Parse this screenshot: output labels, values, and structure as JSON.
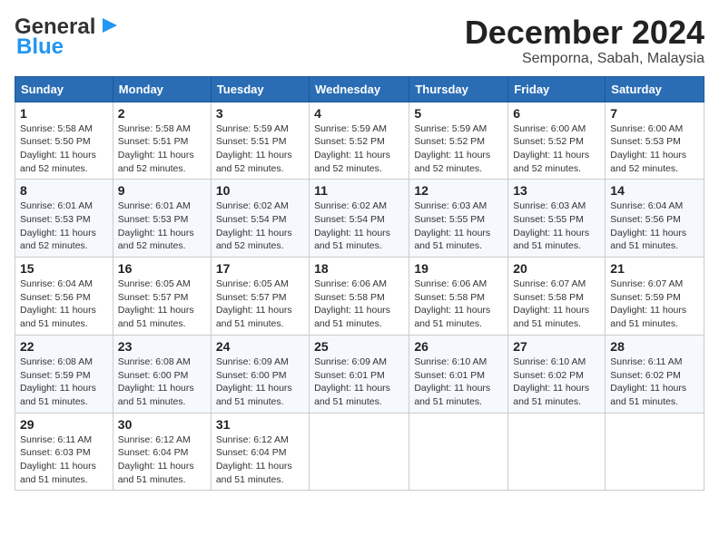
{
  "logo": {
    "part1": "General",
    "part2": "Blue"
  },
  "title": {
    "month": "December 2024",
    "location": "Semporna, Sabah, Malaysia"
  },
  "weekdays": [
    "Sunday",
    "Monday",
    "Tuesday",
    "Wednesday",
    "Thursday",
    "Friday",
    "Saturday"
  ],
  "weeks": [
    [
      {
        "day": "1",
        "sunrise": "5:58 AM",
        "sunset": "5:50 PM",
        "daylight": "11 hours and 52 minutes."
      },
      {
        "day": "2",
        "sunrise": "5:58 AM",
        "sunset": "5:51 PM",
        "daylight": "11 hours and 52 minutes."
      },
      {
        "day": "3",
        "sunrise": "5:59 AM",
        "sunset": "5:51 PM",
        "daylight": "11 hours and 52 minutes."
      },
      {
        "day": "4",
        "sunrise": "5:59 AM",
        "sunset": "5:52 PM",
        "daylight": "11 hours and 52 minutes."
      },
      {
        "day": "5",
        "sunrise": "5:59 AM",
        "sunset": "5:52 PM",
        "daylight": "11 hours and 52 minutes."
      },
      {
        "day": "6",
        "sunrise": "6:00 AM",
        "sunset": "5:52 PM",
        "daylight": "11 hours and 52 minutes."
      },
      {
        "day": "7",
        "sunrise": "6:00 AM",
        "sunset": "5:53 PM",
        "daylight": "11 hours and 52 minutes."
      }
    ],
    [
      {
        "day": "8",
        "sunrise": "6:01 AM",
        "sunset": "5:53 PM",
        "daylight": "11 hours and 52 minutes."
      },
      {
        "day": "9",
        "sunrise": "6:01 AM",
        "sunset": "5:53 PM",
        "daylight": "11 hours and 52 minutes."
      },
      {
        "day": "10",
        "sunrise": "6:02 AM",
        "sunset": "5:54 PM",
        "daylight": "11 hours and 52 minutes."
      },
      {
        "day": "11",
        "sunrise": "6:02 AM",
        "sunset": "5:54 PM",
        "daylight": "11 hours and 51 minutes."
      },
      {
        "day": "12",
        "sunrise": "6:03 AM",
        "sunset": "5:55 PM",
        "daylight": "11 hours and 51 minutes."
      },
      {
        "day": "13",
        "sunrise": "6:03 AM",
        "sunset": "5:55 PM",
        "daylight": "11 hours and 51 minutes."
      },
      {
        "day": "14",
        "sunrise": "6:04 AM",
        "sunset": "5:56 PM",
        "daylight": "11 hours and 51 minutes."
      }
    ],
    [
      {
        "day": "15",
        "sunrise": "6:04 AM",
        "sunset": "5:56 PM",
        "daylight": "11 hours and 51 minutes."
      },
      {
        "day": "16",
        "sunrise": "6:05 AM",
        "sunset": "5:57 PM",
        "daylight": "11 hours and 51 minutes."
      },
      {
        "day": "17",
        "sunrise": "6:05 AM",
        "sunset": "5:57 PM",
        "daylight": "11 hours and 51 minutes."
      },
      {
        "day": "18",
        "sunrise": "6:06 AM",
        "sunset": "5:58 PM",
        "daylight": "11 hours and 51 minutes."
      },
      {
        "day": "19",
        "sunrise": "6:06 AM",
        "sunset": "5:58 PM",
        "daylight": "11 hours and 51 minutes."
      },
      {
        "day": "20",
        "sunrise": "6:07 AM",
        "sunset": "5:58 PM",
        "daylight": "11 hours and 51 minutes."
      },
      {
        "day": "21",
        "sunrise": "6:07 AM",
        "sunset": "5:59 PM",
        "daylight": "11 hours and 51 minutes."
      }
    ],
    [
      {
        "day": "22",
        "sunrise": "6:08 AM",
        "sunset": "5:59 PM",
        "daylight": "11 hours and 51 minutes."
      },
      {
        "day": "23",
        "sunrise": "6:08 AM",
        "sunset": "6:00 PM",
        "daylight": "11 hours and 51 minutes."
      },
      {
        "day": "24",
        "sunrise": "6:09 AM",
        "sunset": "6:00 PM",
        "daylight": "11 hours and 51 minutes."
      },
      {
        "day": "25",
        "sunrise": "6:09 AM",
        "sunset": "6:01 PM",
        "daylight": "11 hours and 51 minutes."
      },
      {
        "day": "26",
        "sunrise": "6:10 AM",
        "sunset": "6:01 PM",
        "daylight": "11 hours and 51 minutes."
      },
      {
        "day": "27",
        "sunrise": "6:10 AM",
        "sunset": "6:02 PM",
        "daylight": "11 hours and 51 minutes."
      },
      {
        "day": "28",
        "sunrise": "6:11 AM",
        "sunset": "6:02 PM",
        "daylight": "11 hours and 51 minutes."
      }
    ],
    [
      {
        "day": "29",
        "sunrise": "6:11 AM",
        "sunset": "6:03 PM",
        "daylight": "11 hours and 51 minutes."
      },
      {
        "day": "30",
        "sunrise": "6:12 AM",
        "sunset": "6:04 PM",
        "daylight": "11 hours and 51 minutes."
      },
      {
        "day": "31",
        "sunrise": "6:12 AM",
        "sunset": "6:04 PM",
        "daylight": "11 hours and 51 minutes."
      },
      null,
      null,
      null,
      null
    ]
  ]
}
